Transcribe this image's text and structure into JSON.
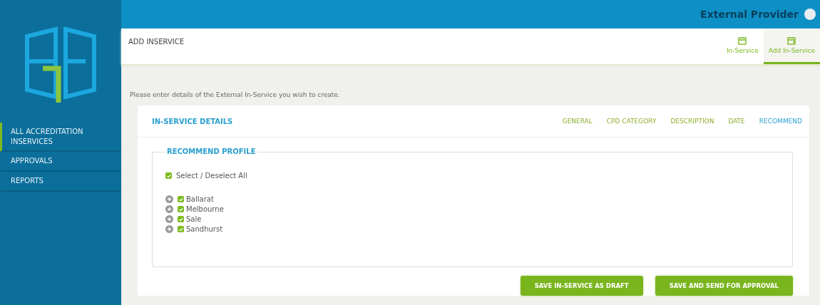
{
  "user": {
    "name": "External Provider"
  },
  "sidebar": {
    "items": [
      {
        "label": "ALL ACCREDITATION INSERVICES",
        "selected": true
      },
      {
        "label": "APPROVALS",
        "selected": false
      },
      {
        "label": "REPORTS",
        "selected": false
      }
    ]
  },
  "header": {
    "title": "ADD INSERVICE",
    "tabs": [
      {
        "label": "In-Service",
        "selected": false,
        "kind": "calendar"
      },
      {
        "label": "Add In-Service",
        "selected": true,
        "kind": "calendar-add"
      }
    ]
  },
  "intro": "Please enter details of the External In-Service you wish to create.",
  "card": {
    "title": "IN-SERVICE DETAILS",
    "sections": [
      {
        "label": "GENERAL",
        "selected": false
      },
      {
        "label": "CPD CATEGORY",
        "selected": false
      },
      {
        "label": "DESCRIPTION",
        "selected": false
      },
      {
        "label": "DATE",
        "selected": false
      },
      {
        "label": "RECOMMEND",
        "selected": true
      }
    ],
    "fieldset": {
      "legend": "RECOMMEND PROFILE",
      "select_all": {
        "label": "Select / Deselect All",
        "checked": true
      },
      "tree": [
        {
          "label": "Ballarat",
          "checked": true,
          "expanded": false
        },
        {
          "label": "Melbourne",
          "checked": true,
          "expanded": false
        },
        {
          "label": "Sale",
          "checked": true,
          "expanded": false
        },
        {
          "label": "Sandhurst",
          "checked": true,
          "expanded": false
        }
      ]
    },
    "buttons": [
      "SAVE IN-SERVICE AS DRAFT",
      "SAVE AND SEND FOR APPROVAL"
    ]
  }
}
